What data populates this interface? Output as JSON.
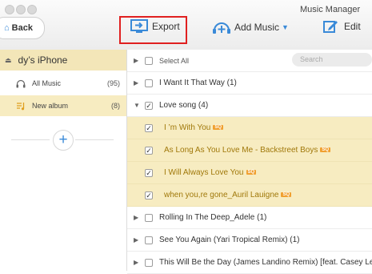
{
  "window": {
    "title": "Music Manager"
  },
  "toolbar": {
    "back_label": "Back",
    "export_label": "Export",
    "add_music_label": "Add Music",
    "edit_label": "Edit"
  },
  "sidebar": {
    "device_name": "dy’s iPhone",
    "items": [
      {
        "label": "All Music",
        "count": "(95)"
      },
      {
        "label": "New album",
        "count": "(8)"
      }
    ]
  },
  "list": {
    "select_all_label": "Select All",
    "search_placeholder": "Search",
    "rows": [
      {
        "text": "I Want It That Way (1)"
      },
      {
        "text": "Love song (4)"
      },
      {
        "text": "I ’m With You",
        "badge": "SQ"
      },
      {
        "text": "As Long As You Love Me - Backstreet Boys",
        "badge": "SQ"
      },
      {
        "text": "I Will Always Love You",
        "badge": "SQ"
      },
      {
        "text": "when you,re gone_Auril Lauigne",
        "badge": "SQ"
      },
      {
        "text": "Rolling In The Deep_Adele (1)"
      },
      {
        "text": "See You Again (Yari Tropical Remix) (1)"
      },
      {
        "text": "This Will Be the Day (James Landino Remix) [feat. Casey Lee"
      }
    ]
  },
  "colors": {
    "accent": "#3a8ad8",
    "selection": "#f7ecc1",
    "badge": "#f0a030",
    "highlight_border": "#e02020"
  }
}
